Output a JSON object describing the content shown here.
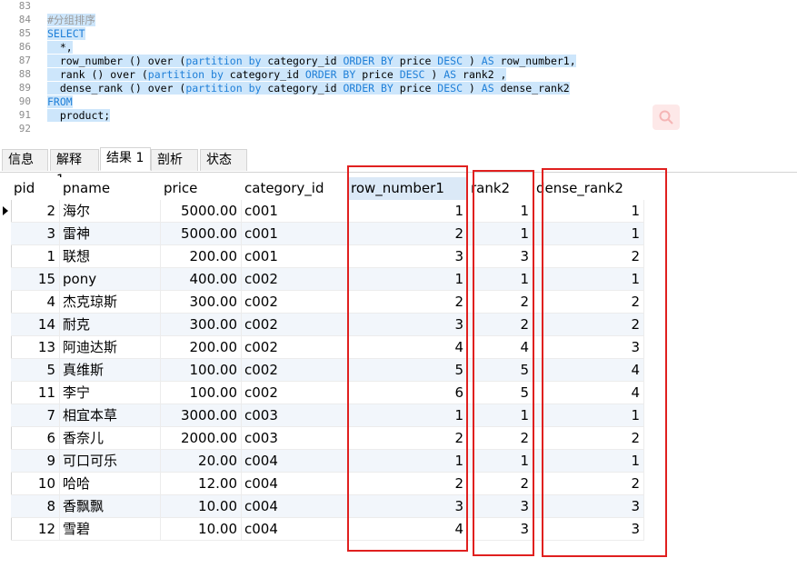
{
  "editor": {
    "lines": [
      {
        "n": "83",
        "parts": []
      },
      {
        "n": "84",
        "parts": [
          {
            "t": "#分组排序",
            "c": "cm"
          }
        ]
      },
      {
        "n": "85",
        "parts": [
          {
            "t": "SELECT",
            "c": "kw"
          }
        ]
      },
      {
        "n": "86",
        "parts": [
          {
            "t": "  *,",
            "c": ""
          }
        ]
      },
      {
        "n": "87",
        "parts": [
          {
            "t": "  row_number () over (",
            "c": ""
          },
          {
            "t": "partition by",
            "c": "kw"
          },
          {
            "t": " category_id ",
            "c": ""
          },
          {
            "t": "ORDER BY",
            "c": "kw"
          },
          {
            "t": " price ",
            "c": ""
          },
          {
            "t": "DESC",
            "c": "kw"
          },
          {
            "t": " ) ",
            "c": ""
          },
          {
            "t": "AS",
            "c": "kw"
          },
          {
            "t": " row_number1,",
            "c": ""
          }
        ]
      },
      {
        "n": "88",
        "parts": [
          {
            "t": "  rank () over (",
            "c": ""
          },
          {
            "t": "partition by",
            "c": "kw"
          },
          {
            "t": " category_id ",
            "c": ""
          },
          {
            "t": "ORDER BY",
            "c": "kw"
          },
          {
            "t": " price ",
            "c": ""
          },
          {
            "t": "DESC",
            "c": "kw"
          },
          {
            "t": " ) ",
            "c": ""
          },
          {
            "t": "AS",
            "c": "kw"
          },
          {
            "t": " rank2 ,",
            "c": ""
          }
        ]
      },
      {
        "n": "89",
        "parts": [
          {
            "t": "  dense_rank () over (",
            "c": ""
          },
          {
            "t": "partition by",
            "c": "kw"
          },
          {
            "t": " category_id ",
            "c": ""
          },
          {
            "t": "ORDER BY",
            "c": "kw"
          },
          {
            "t": " price ",
            "c": ""
          },
          {
            "t": "DESC",
            "c": "kw"
          },
          {
            "t": " ) ",
            "c": ""
          },
          {
            "t": "AS",
            "c": "kw"
          },
          {
            "t": " dense_rank2",
            "c": ""
          }
        ]
      },
      {
        "n": "90",
        "parts": [
          {
            "t": "FROM",
            "c": "kw"
          }
        ]
      },
      {
        "n": "91",
        "parts": [
          {
            "t": "  product;",
            "c": ""
          }
        ]
      },
      {
        "n": "92",
        "parts": []
      }
    ]
  },
  "tabs": [
    {
      "label": "信息",
      "active": false
    },
    {
      "label": "解释 1",
      "active": false
    },
    {
      "label": "结果 1",
      "active": true
    },
    {
      "label": "剖析",
      "active": false
    },
    {
      "label": "状态",
      "active": false
    }
  ],
  "table": {
    "columns": [
      "pid",
      "pname",
      "price",
      "category_id",
      "row_number1",
      "rank2",
      "dense_rank2"
    ],
    "rows": [
      [
        "2",
        "海尔",
        "5000.00",
        "c001",
        "1",
        "1",
        "1"
      ],
      [
        "3",
        "雷神",
        "5000.00",
        "c001",
        "2",
        "1",
        "1"
      ],
      [
        "1",
        "联想",
        "200.00",
        "c001",
        "3",
        "3",
        "2"
      ],
      [
        "15",
        "pony",
        "400.00",
        "c002",
        "1",
        "1",
        "1"
      ],
      [
        "4",
        "杰克琼斯",
        "300.00",
        "c002",
        "2",
        "2",
        "2"
      ],
      [
        "14",
        "耐克",
        "300.00",
        "c002",
        "3",
        "2",
        "2"
      ],
      [
        "13",
        "阿迪达斯",
        "200.00",
        "c002",
        "4",
        "4",
        "3"
      ],
      [
        "5",
        "真维斯",
        "100.00",
        "c002",
        "5",
        "5",
        "4"
      ],
      [
        "11",
        "李宁",
        "100.00",
        "c002",
        "6",
        "5",
        "4"
      ],
      [
        "7",
        "相宜本草",
        "3000.00",
        "c003",
        "1",
        "1",
        "1"
      ],
      [
        "6",
        "香奈儿",
        "2000.00",
        "c003",
        "2",
        "2",
        "2"
      ],
      [
        "9",
        "可口可乐",
        "20.00",
        "c004",
        "1",
        "1",
        "1"
      ],
      [
        "10",
        "哈哈",
        "12.00",
        "c004",
        "2",
        "2",
        "2"
      ],
      [
        "8",
        "香飘飘",
        "10.00",
        "c004",
        "3",
        "3",
        "3"
      ],
      [
        "12",
        "雪碧",
        "10.00",
        "c004",
        "4",
        "3",
        "3"
      ]
    ],
    "selected_column": "row_number1",
    "current_row_index": 0
  },
  "colors": {
    "highlight_box": "#e0201f",
    "keyword": "#1e7fd8",
    "selection": "#cde6fb"
  }
}
